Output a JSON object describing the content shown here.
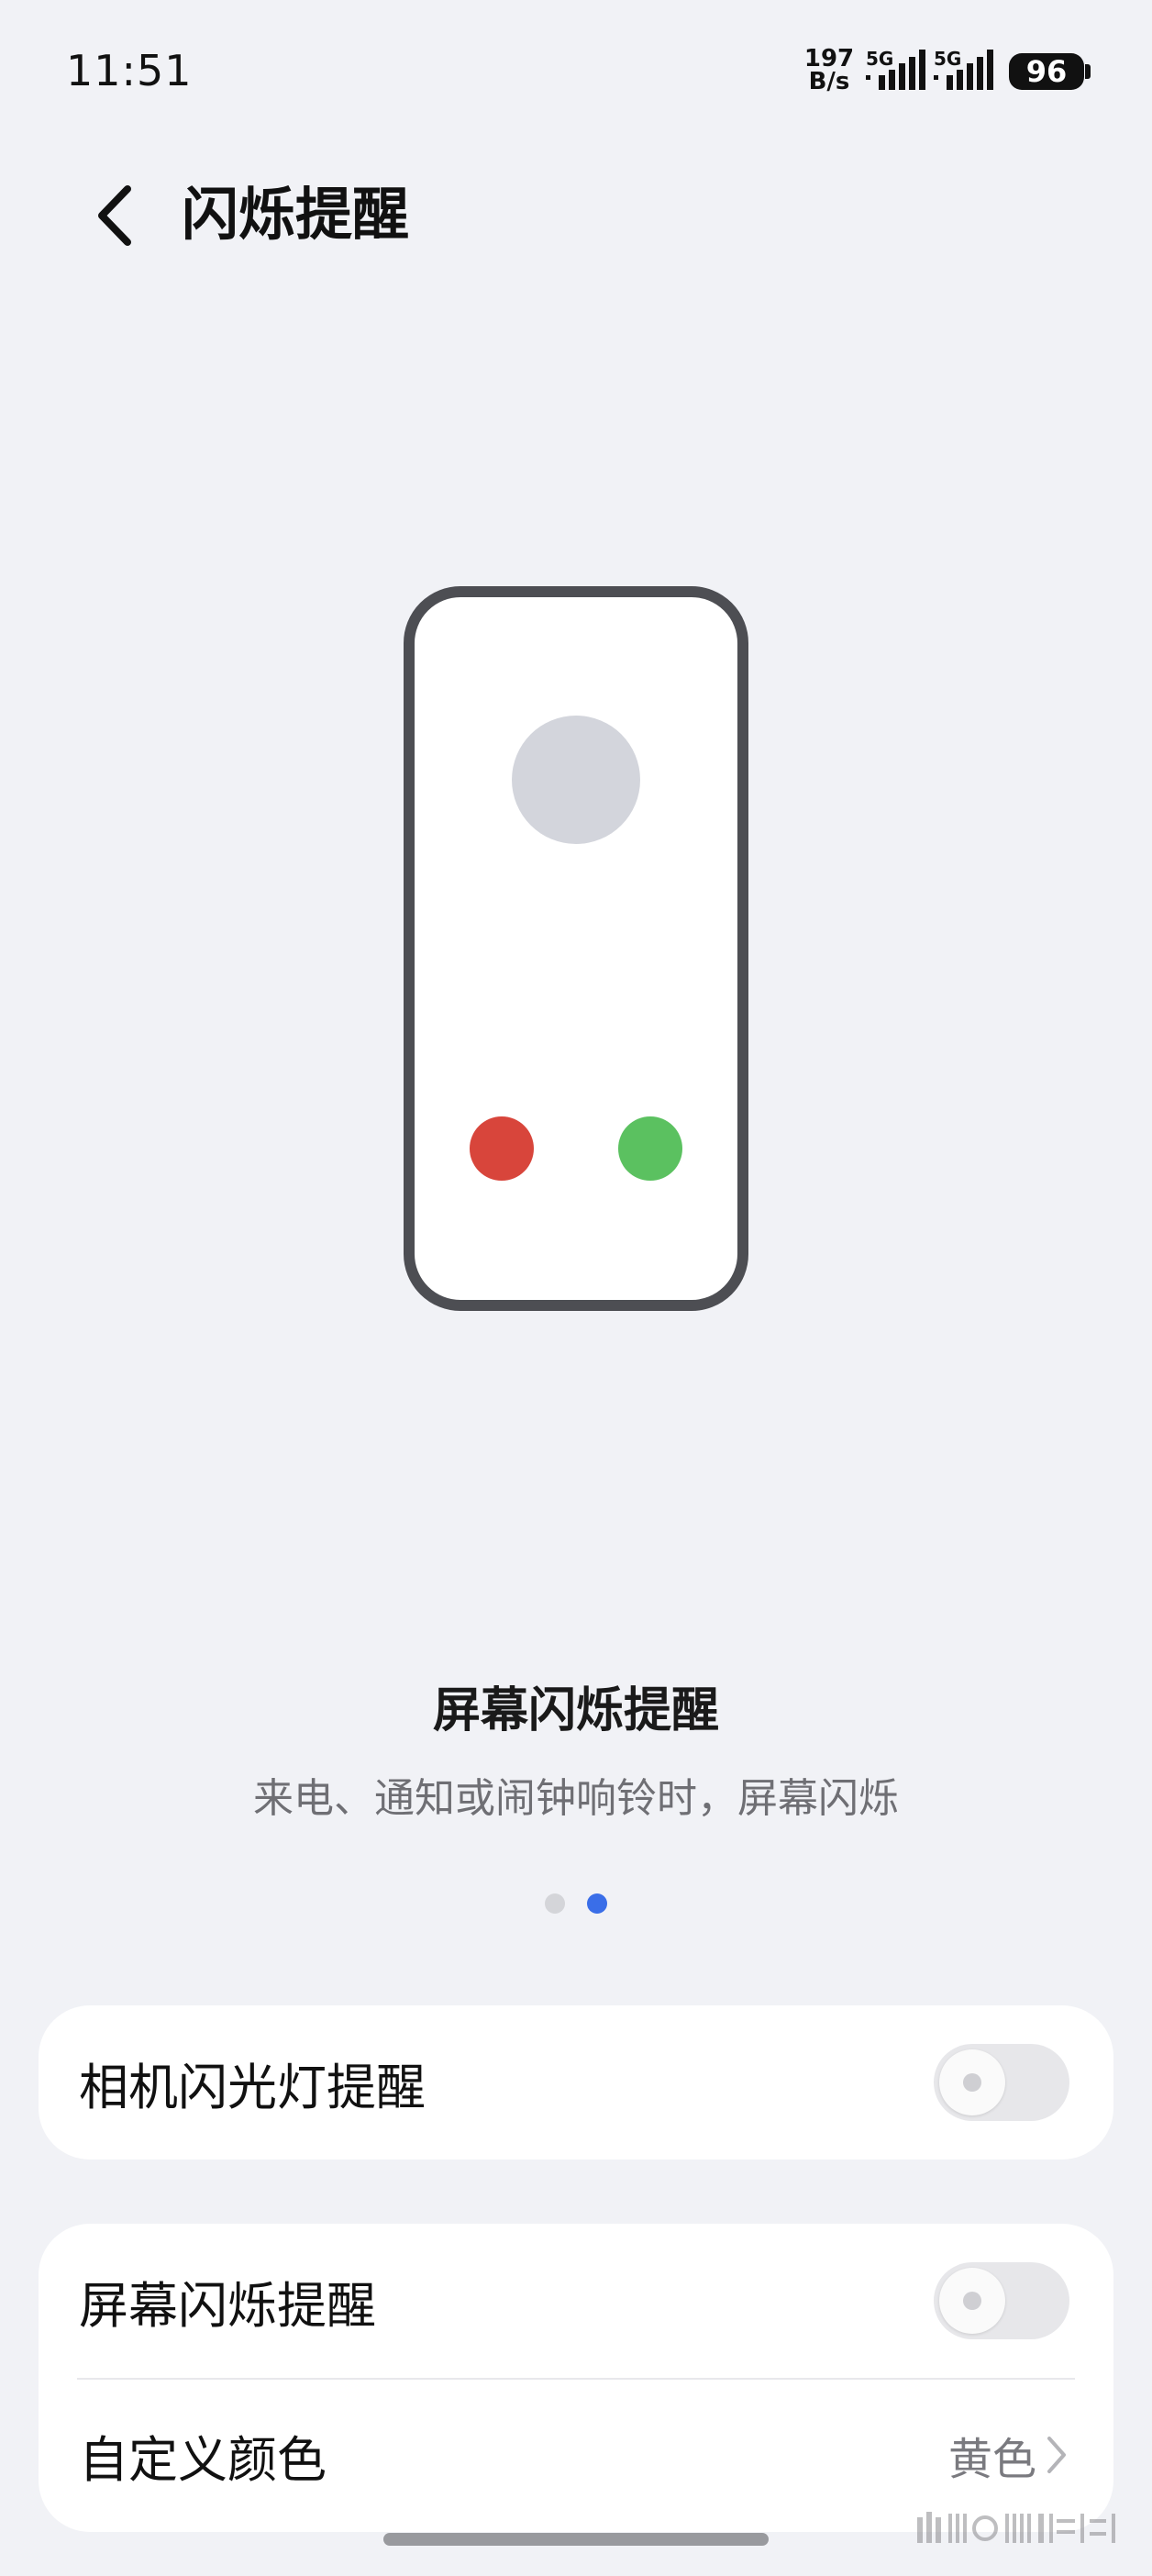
{
  "status_bar": {
    "time": "11:51",
    "net_speed_value": "197",
    "net_speed_unit": "B/s",
    "signal_1_label": "5G",
    "signal_2_label": "5G",
    "battery": "96"
  },
  "header": {
    "title": "闪烁提醒"
  },
  "illustration": {
    "colors": {
      "frame": "#4d4e53",
      "avatar": "#d3d5dc",
      "decline": "#d8453b",
      "accept": "#5bc160"
    }
  },
  "feature": {
    "title": "屏幕闪烁提醒",
    "description": "来电、通知或闹钟响铃时，屏幕闪烁"
  },
  "pager": {
    "count": 2,
    "active_index": 1,
    "active_color": "#3a6ee8"
  },
  "settings": {
    "camera_flash": {
      "label": "相机闪光灯提醒",
      "enabled": false
    },
    "screen_flash": {
      "label": "屏幕闪烁提醒",
      "enabled": false
    },
    "custom_color": {
      "label": "自定义颜色",
      "value": "黄色"
    }
  }
}
